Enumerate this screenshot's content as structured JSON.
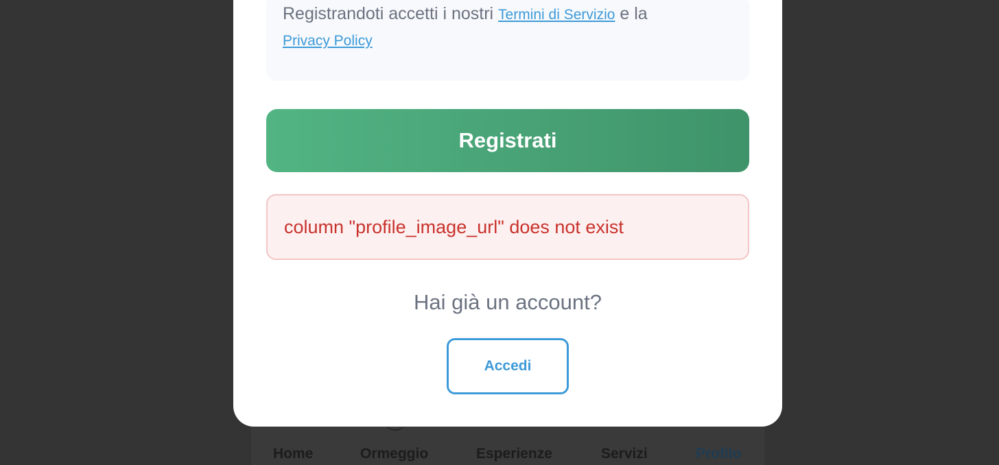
{
  "tabbar": {
    "items": [
      {
        "label": "Home"
      },
      {
        "label": "Ormeggio"
      },
      {
        "label": "Esperienze"
      },
      {
        "label": "Servizi"
      },
      {
        "label": "Profilo",
        "active": true
      }
    ]
  },
  "modal": {
    "terms": {
      "prefix": "Registrandoti accetti i nostri",
      "terms_link": "Termini di Servizio",
      "middle": "e la",
      "privacy_link": "Privacy Policy"
    },
    "register_button": "Registrati",
    "error_message": "column \"profile_image_url\" does not exist",
    "have_account": "Hai già un account?",
    "login_button": "Accedi"
  },
  "colors": {
    "accent_blue": "#3d9ad8",
    "primary_green": "#4aa877",
    "error_red": "#c8322c",
    "overlay": "#343434"
  }
}
